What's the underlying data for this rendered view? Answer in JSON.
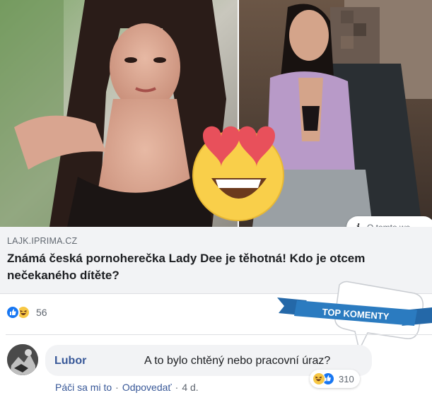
{
  "link": {
    "domain": "LAJK.IPRIMA.CZ",
    "title": "Známá česká pornoherečka Lady Dee je těhotná! Kdo je otcem nečekaného dítěte?",
    "info_label": "O tomto we"
  },
  "post_reactions": {
    "count": "56",
    "types": [
      "like-icon",
      "haha-icon"
    ]
  },
  "banner": {
    "label": "TOP KOMENTY",
    "color": "#2b7bc0"
  },
  "comment": {
    "author": "Lubor",
    "text": "A to bylo chtěný nebo pracovní úraz?",
    "reaction_count": "310",
    "reaction_types": [
      "haha-icon",
      "like-icon"
    ],
    "actions": {
      "like": "Páči sa mi to",
      "sep1": "·",
      "reply": "Odpovedať",
      "sep2": "·",
      "time": "4 d."
    }
  },
  "colors": {
    "facebook_blue": "#1877f2",
    "link_color": "#385898",
    "secondary_text": "#606770",
    "card_bg": "#f2f3f5"
  }
}
